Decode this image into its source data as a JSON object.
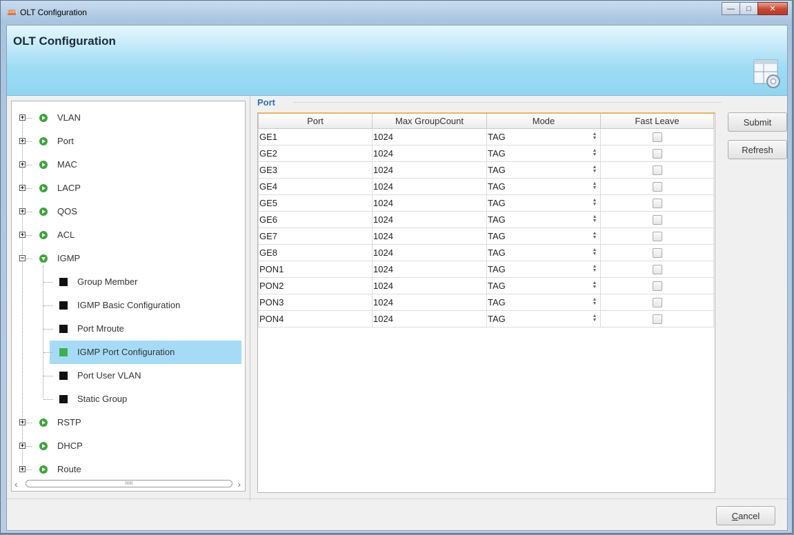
{
  "window": {
    "title": "OLT Configuration",
    "app_icon_text": "EMS",
    "controls": {
      "minimize": "—",
      "maximize": "□",
      "close": "✕"
    }
  },
  "banner": {
    "title": "OLT Configuration",
    "icon": "config-gear-icon"
  },
  "tree": {
    "nodes": [
      {
        "label": "VLAN",
        "expanded": false
      },
      {
        "label": "Port",
        "expanded": false
      },
      {
        "label": "MAC",
        "expanded": false
      },
      {
        "label": "LACP",
        "expanded": false
      },
      {
        "label": "QOS",
        "expanded": false
      },
      {
        "label": "ACL",
        "expanded": false
      },
      {
        "label": "IGMP",
        "expanded": true
      },
      {
        "label": "RSTP",
        "expanded": false
      },
      {
        "label": "DHCP",
        "expanded": false
      },
      {
        "label": "Route",
        "expanded": false
      }
    ],
    "igmp_children": [
      {
        "label": "Group Member",
        "selected": false
      },
      {
        "label": "IGMP Basic Configuration",
        "selected": false
      },
      {
        "label": "Port Mroute",
        "selected": false
      },
      {
        "label": "IGMP Port Configuration",
        "selected": true
      },
      {
        "label": "Port User VLAN",
        "selected": false
      },
      {
        "label": "Static Group",
        "selected": false
      }
    ],
    "scroll_thumb_grip": "IIIIII"
  },
  "section": {
    "title": "Port"
  },
  "table": {
    "headers": [
      "Port",
      "Max GroupCount",
      "Mode",
      "Fast Leave"
    ],
    "rows": [
      {
        "port": "GE1",
        "max": "1024",
        "mode": "TAG",
        "fast_leave": false
      },
      {
        "port": "GE2",
        "max": "1024",
        "mode": "TAG",
        "fast_leave": false
      },
      {
        "port": "GE3",
        "max": "1024",
        "mode": "TAG",
        "fast_leave": false
      },
      {
        "port": "GE4",
        "max": "1024",
        "mode": "TAG",
        "fast_leave": false
      },
      {
        "port": "GE5",
        "max": "1024",
        "mode": "TAG",
        "fast_leave": false
      },
      {
        "port": "GE6",
        "max": "1024",
        "mode": "TAG",
        "fast_leave": false
      },
      {
        "port": "GE7",
        "max": "1024",
        "mode": "TAG",
        "fast_leave": false
      },
      {
        "port": "GE8",
        "max": "1024",
        "mode": "TAG",
        "fast_leave": false
      },
      {
        "port": "PON1",
        "max": "1024",
        "mode": "TAG",
        "fast_leave": false
      },
      {
        "port": "PON2",
        "max": "1024",
        "mode": "TAG",
        "fast_leave": false
      },
      {
        "port": "PON3",
        "max": "1024",
        "mode": "TAG",
        "fast_leave": false
      },
      {
        "port": "PON4",
        "max": "1024",
        "mode": "TAG",
        "fast_leave": false
      }
    ]
  },
  "buttons": {
    "submit": "Submit",
    "refresh": "Refresh",
    "cancel_mnemonic": "C",
    "cancel_rest": "ancel"
  },
  "colors": {
    "accent": "#2a73b5",
    "selection": "#a6dbf8",
    "table_top_border": "#f2b25a",
    "node_ball": "#3aa63a"
  }
}
